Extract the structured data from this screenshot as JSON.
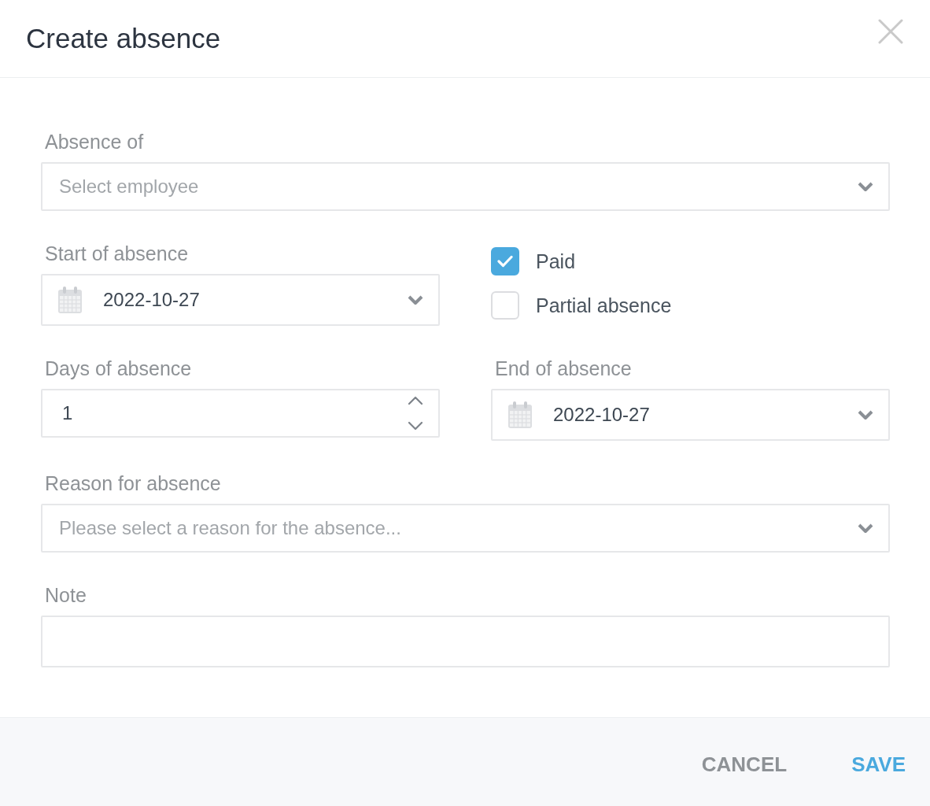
{
  "dialog": {
    "title": "Create absence"
  },
  "employee": {
    "label": "Absence of",
    "placeholder": "Select employee"
  },
  "start": {
    "label": "Start of absence",
    "value": "2022-10-27"
  },
  "options": [
    {
      "label": "Paid",
      "checked": true
    },
    {
      "label": "Partial absence",
      "checked": false
    }
  ],
  "days": {
    "label": "Days of absence",
    "value": "1"
  },
  "end": {
    "label": "End of absence",
    "value": "2022-10-27"
  },
  "reason": {
    "label": "Reason for absence",
    "placeholder": "Please select a reason for the absence..."
  },
  "note": {
    "label": "Note"
  },
  "buttons": [
    {
      "label": "CANCEL",
      "kind": "secondary"
    },
    {
      "label": "SAVE",
      "kind": "primary"
    }
  ]
}
